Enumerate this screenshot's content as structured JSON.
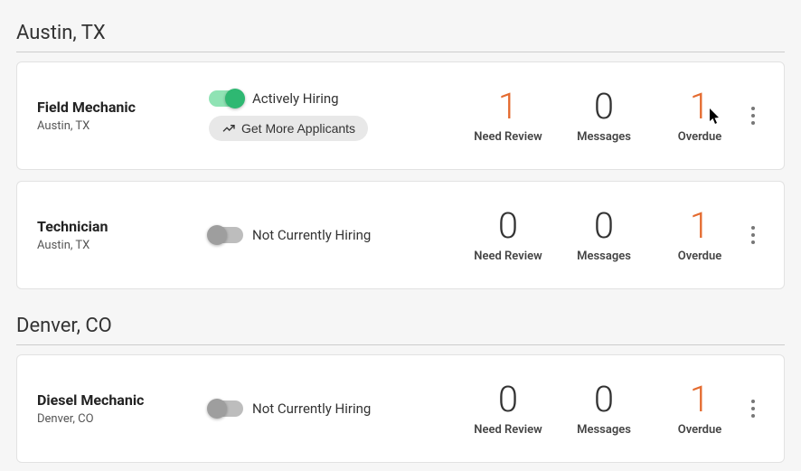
{
  "metric_labels": {
    "review": "Need Review",
    "messages": "Messages",
    "overdue": "Overdue"
  },
  "status_labels": {
    "active": "Actively Hiring",
    "inactive": "Not Currently Hiring"
  },
  "chip_label": "Get More Applicants",
  "groups": [
    {
      "location": "Austin, TX",
      "jobs": [
        {
          "title": "Field Mechanic",
          "sublocation": "Austin, TX",
          "active": true,
          "show_chip": true,
          "metrics": {
            "review": 1,
            "messages": 0,
            "overdue": 1
          },
          "accents": {
            "review": true,
            "messages": false,
            "overdue": true
          }
        },
        {
          "title": "Technician",
          "sublocation": "Austin, TX",
          "active": false,
          "show_chip": false,
          "metrics": {
            "review": 0,
            "messages": 0,
            "overdue": 1
          },
          "accents": {
            "review": false,
            "messages": false,
            "overdue": true
          }
        }
      ]
    },
    {
      "location": "Denver, CO",
      "jobs": [
        {
          "title": "Diesel Mechanic",
          "sublocation": "Denver, CO",
          "active": false,
          "show_chip": false,
          "metrics": {
            "review": 0,
            "messages": 0,
            "overdue": 1
          },
          "accents": {
            "review": false,
            "messages": false,
            "overdue": true
          }
        }
      ]
    }
  ]
}
